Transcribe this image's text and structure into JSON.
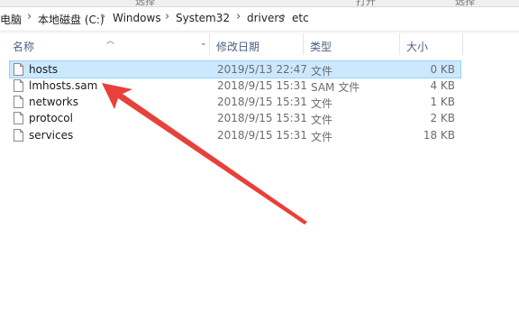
{
  "window": {
    "toolbar_fragments": [
      "选择",
      "打开",
      "选择"
    ]
  },
  "breadcrumb": {
    "items": [
      "电脑",
      "本地磁盘 (C:)",
      "Windows",
      "System32",
      "drivers",
      "etc"
    ],
    "separator": "›"
  },
  "columns": {
    "name": "名称",
    "date": "修改日期",
    "type": "类型",
    "size": "大小"
  },
  "files": [
    {
      "name": "hosts",
      "date": "2019/5/13 22:47",
      "type": "文件",
      "size": "0 KB",
      "selected": true
    },
    {
      "name": "lmhosts.sam",
      "date": "2018/9/15 15:31",
      "type": "SAM 文件",
      "size": "4 KB",
      "selected": false
    },
    {
      "name": "networks",
      "date": "2018/9/15 15:31",
      "type": "文件",
      "size": "1 KB",
      "selected": false
    },
    {
      "name": "protocol",
      "date": "2018/9/15 15:31",
      "type": "文件",
      "size": "2 KB",
      "selected": false
    },
    {
      "name": "services",
      "date": "2018/9/15 15:31",
      "type": "文件",
      "size": "18 KB",
      "selected": false
    }
  ],
  "colors": {
    "selection_bg": "#cce8ff",
    "selection_border": "#99d1ff",
    "annotation_arrow": "#e8403a"
  },
  "icons": {
    "file": "document-icon",
    "sort": "sort-up-icon",
    "separator": "chevron-right-icon"
  }
}
